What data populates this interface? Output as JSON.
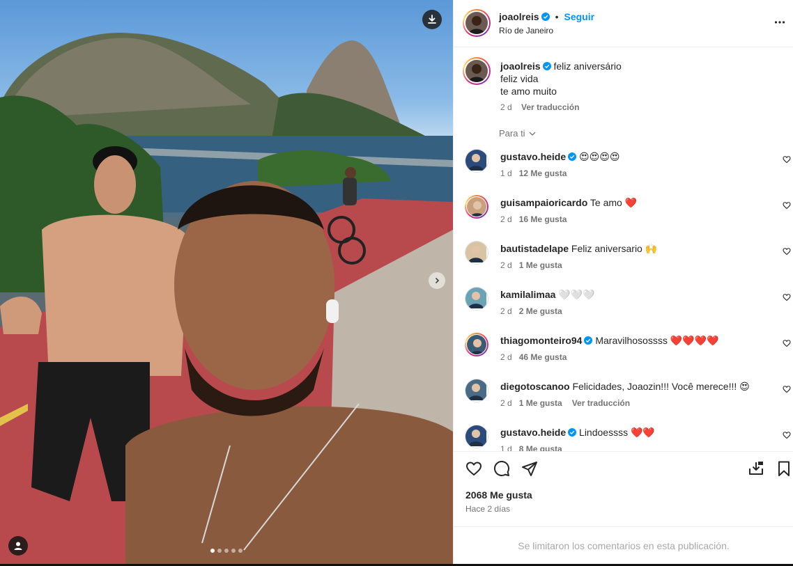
{
  "post": {
    "author": "joaolreis",
    "verified": true,
    "dot": "•",
    "follow_label": "Seguir",
    "location": "Río de Janeiro",
    "more_icon": "more-options-icon"
  },
  "caption": {
    "username": "joaolreis",
    "lines": [
      "feliz aniversário",
      "feliz vida",
      "te amo muito"
    ],
    "time": "2 d",
    "translate": "Ver traducción"
  },
  "sort_label": "Para ti",
  "comments": [
    {
      "username": "gustavo.heide",
      "verified": true,
      "text": "😍😍😍😍",
      "time": "1 d",
      "likes": "12 Me gusta",
      "translate": "",
      "ring": false
    },
    {
      "username": "guisampaioricardo",
      "verified": false,
      "text": "Te amo ❤️",
      "time": "2 d",
      "likes": "16 Me gusta",
      "translate": "",
      "ring": true
    },
    {
      "username": "bautistadelape",
      "verified": false,
      "text": "Feliz aniversario 🙌",
      "time": "2 d",
      "likes": "1 Me gusta",
      "translate": "",
      "ring": false
    },
    {
      "username": "kamilalimaa",
      "verified": false,
      "text": "🤍🤍🤍",
      "time": "2 d",
      "likes": "2 Me gusta",
      "translate": "",
      "ring": false
    },
    {
      "username": "thiagomonteiro94",
      "verified": true,
      "text": "Maravilhosossss ❤️❤️❤️❤️",
      "time": "2 d",
      "likes": "46 Me gusta",
      "translate": "",
      "ring": true
    },
    {
      "username": "diegotoscanoo",
      "verified": false,
      "text": "Felicidades, Joaozin!!! Você merece!!! 😍",
      "time": "2 d",
      "likes": "1 Me gusta",
      "translate": "Ver traducción",
      "ring": false
    },
    {
      "username": "gustavo.heide",
      "verified": true,
      "text": "Lindoessss ❤️❤️",
      "time": "1 d",
      "likes": "8 Me gusta",
      "translate": "",
      "ring": false
    }
  ],
  "footer": {
    "likes": "2068 Me gusta",
    "when": "Hace 2 días",
    "comments_limited": "Se limitaron los comentarios en esta publicación."
  },
  "carousel": {
    "count": 5,
    "active": 0
  },
  "colors": {
    "accent": "#0095f6",
    "text": "#262626",
    "muted": "#737373",
    "heart": "#ed4956"
  }
}
